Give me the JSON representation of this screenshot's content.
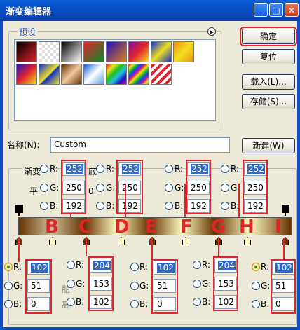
{
  "window": {
    "title": "渐变编辑器",
    "minimize": "_",
    "maximize": "□",
    "close": "✕"
  },
  "presets": {
    "label": "预设",
    "menu_icon": "▶"
  },
  "buttons": {
    "ok": "确定",
    "reset": "复位",
    "load": "载入(L)...",
    "save": "存储(S)...",
    "new": "新建(W)"
  },
  "name": {
    "label": "名称(N):",
    "value": "Custom"
  },
  "partial_labels": {
    "type": "渐变",
    "smooth": "平",
    "bottom": "底",
    "fraction": "0",
    "loc1": "朋",
    "loc2": "离"
  },
  "upper_stops": [
    {
      "r": "252",
      "g": "250",
      "b": "192"
    },
    {
      "r": "252",
      "g": "250",
      "b": "192"
    },
    {
      "r": "252",
      "g": "250",
      "b": "192"
    },
    {
      "r": "252",
      "g": "250",
      "b": "192"
    }
  ],
  "lower_stops": [
    {
      "r": "102",
      "g": "51",
      "b": "0"
    },
    {
      "r": "204",
      "g": "153",
      "b": "102"
    },
    {
      "r": "102",
      "g": "51",
      "b": "0"
    },
    {
      "r": "204",
      "g": "153",
      "b": "102"
    },
    {
      "r": "102",
      "g": "51",
      "b": "0"
    }
  ],
  "channel_labels": {
    "r": "R:",
    "g": "G:",
    "b": "B:"
  },
  "stop_letters": [
    "B",
    "C",
    "D",
    "E",
    "F",
    "G",
    "H",
    "I"
  ],
  "colors": {
    "accent": "#e0242c",
    "titlebar": "#0b4fc4",
    "dark_brown": "#663300",
    "light_cream": "#fcfac0"
  }
}
